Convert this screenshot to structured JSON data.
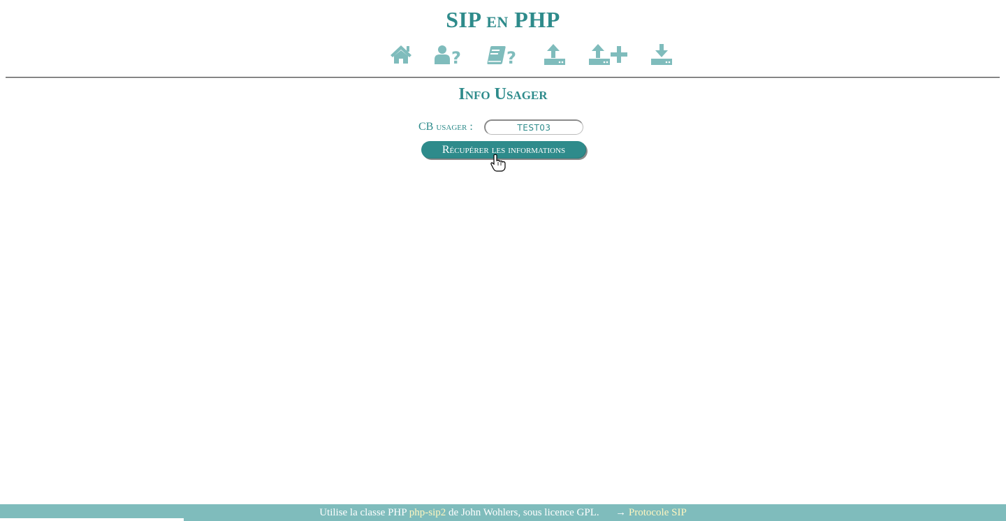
{
  "header": {
    "title": "SIP en PHP"
  },
  "nav": {
    "items": [
      {
        "icon": "home-icon",
        "name": "nav-home"
      },
      {
        "icon": "user-question-icon",
        "name": "nav-user-info"
      },
      {
        "icon": "book-question-icon",
        "name": "nav-item-info"
      },
      {
        "icon": "upload-icon",
        "name": "nav-checkout"
      },
      {
        "icon": "upload-plus-icon",
        "name": "nav-renew"
      },
      {
        "icon": "download-icon",
        "name": "nav-checkin"
      }
    ]
  },
  "section": {
    "title": "Info Usager"
  },
  "form": {
    "label": "CB usager :",
    "value": "TEST03",
    "submit_label": "Récupérer les informations"
  },
  "footer": {
    "text_before": "Utilise la classe PHP",
    "link_lib": "php-sip2",
    "text_after": "de John Wohlers, sous licence GPL.",
    "arrow": "→",
    "link_protocol": "Protocole SIP"
  },
  "colors": {
    "accent": "#2e8b8b",
    "icon": "#7fbcbc",
    "footer_bg": "#7fbcbc",
    "footer_link": "#fff6c0"
  }
}
